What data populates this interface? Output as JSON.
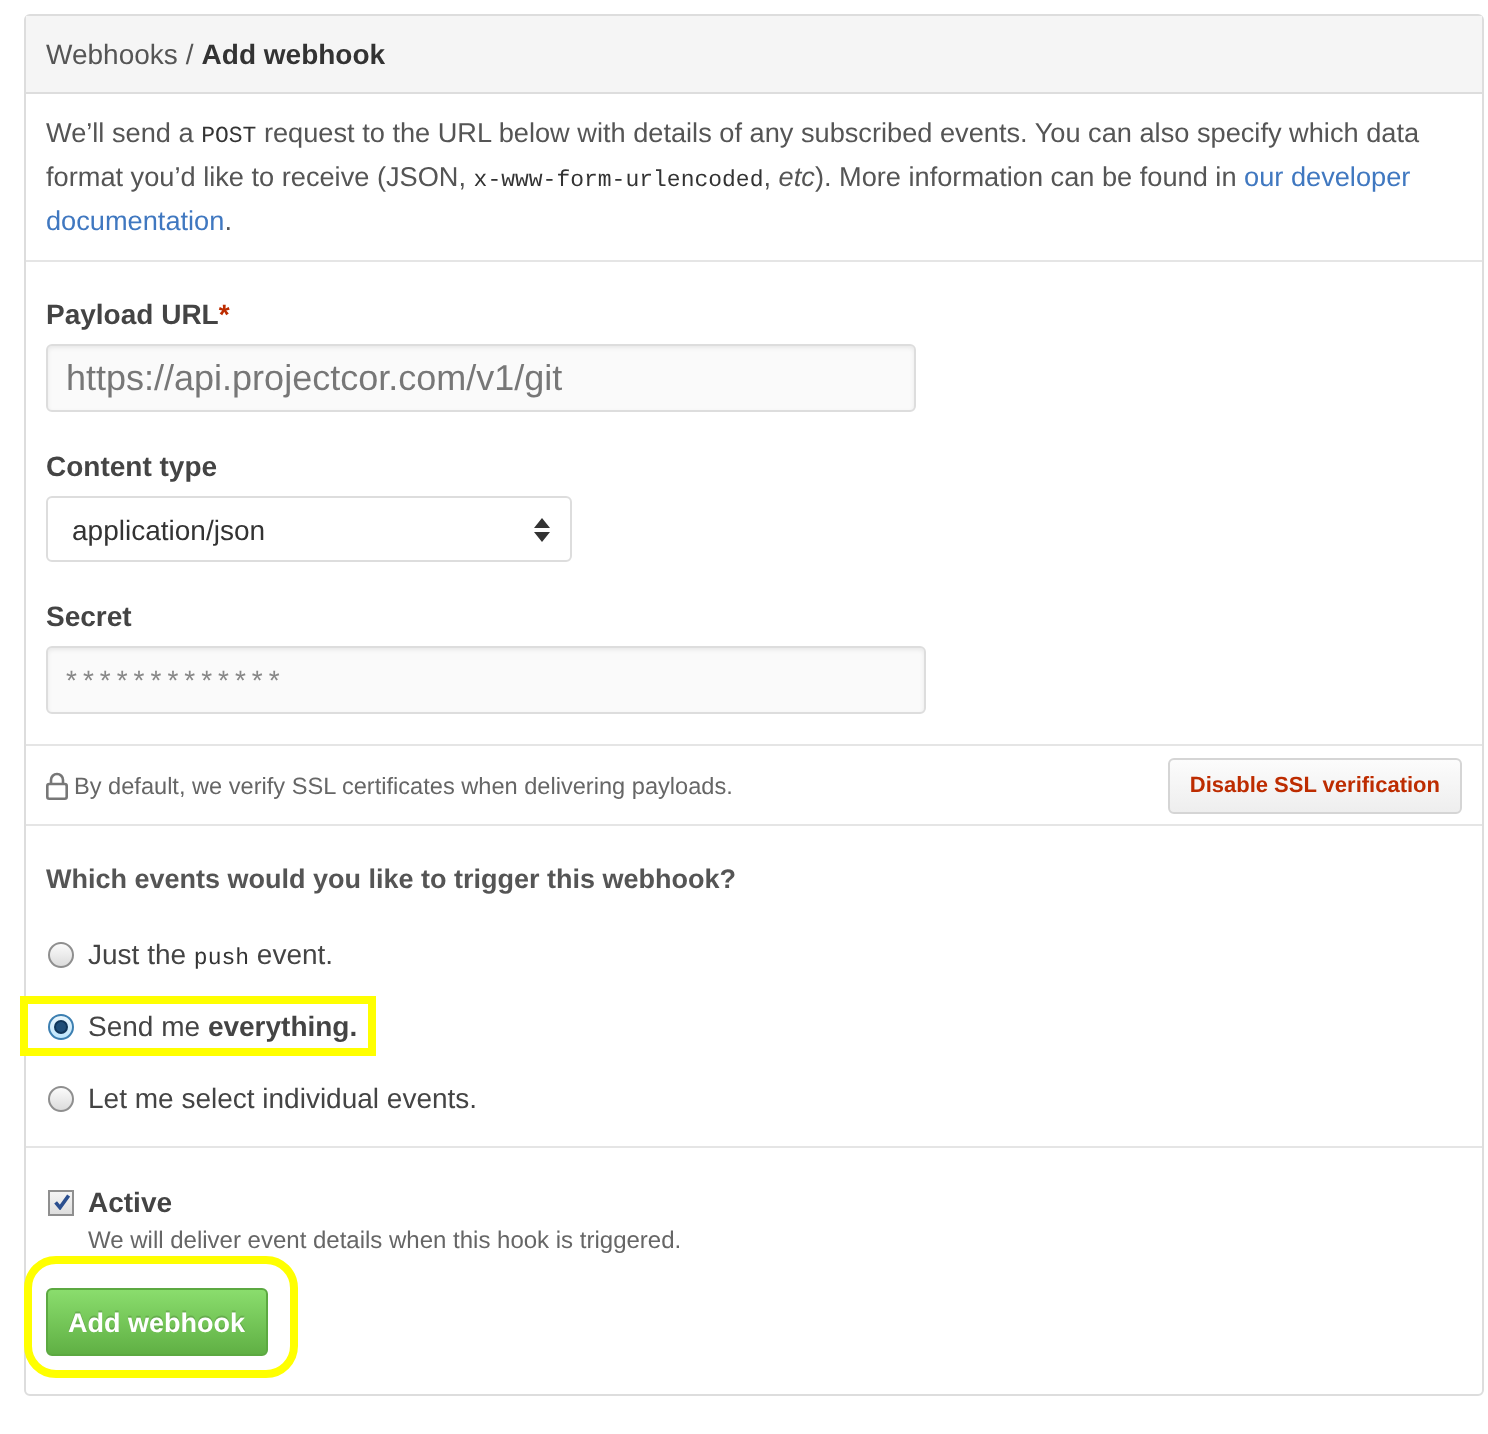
{
  "breadcrumb": {
    "parent": "Webhooks",
    "separator": "/",
    "current": "Add webhook"
  },
  "intro": [
    {
      "kind": "text",
      "text": "We’ll send a "
    },
    {
      "kind": "code",
      "text": "POST"
    },
    {
      "kind": "text",
      "text": " request to the URL below with details of any subscribed events. You can also specify which data format you’d like to receive (JSON, "
    },
    {
      "kind": "code",
      "text": "x-www-form-urlencoded"
    },
    {
      "kind": "text",
      "text": ", *etc*). More information can be found in "
    },
    {
      "kind": "link",
      "text": "our developer"
    },
    {
      "kind": "link",
      "text": "documentation"
    },
    {
      "kind": "text",
      "text": "."
    }
  ],
  "fields": [
    {
      "kind": "url",
      "label": "Payload URL",
      "required_mark": "*",
      "value": "https://api.projectcor.com/v1/git"
    },
    {
      "kind": "select",
      "label": "Content type",
      "value": "application/json"
    },
    {
      "kind": "secret",
      "label": "Secret",
      "value": "*************"
    }
  ],
  "ssl": {
    "note": "By default, we verify SSL certificates when delivering payloads.",
    "button": "Disable SSL verification"
  },
  "events": {
    "question": "Which events would you like to trigger this webhook?",
    "options": [
      {
        "label": [
          {
            "kind": "text",
            "text": "Just the "
          },
          {
            "kind": "code",
            "text": "push"
          },
          {
            "kind": "text",
            "text": " event."
          }
        ],
        "selected": false,
        "highlighted": false
      },
      {
        "label": [
          {
            "kind": "text",
            "text": "Send me **everything.**"
          }
        ],
        "selected": true,
        "highlighted": true
      },
      {
        "label": [
          {
            "kind": "text",
            "text": "Let me select individual events."
          }
        ],
        "selected": false,
        "highlighted": false
      }
    ]
  },
  "active": {
    "label": "Active",
    "checked": true,
    "description": "We will deliver event details when this hook is triggered."
  },
  "submit": {
    "label": "Add webhook",
    "highlighted": true
  }
}
